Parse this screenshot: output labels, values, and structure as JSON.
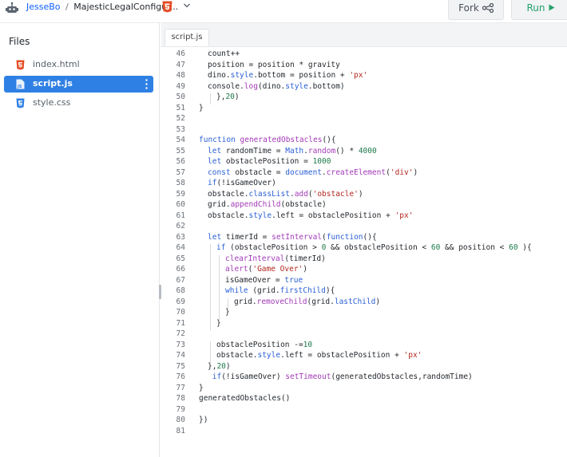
{
  "header": {
    "owner": "JesseBo",
    "separator": "/",
    "repl_name": "MajesticLegalConfigur...",
    "fork_label": "Fork",
    "run_label": "Run"
  },
  "sidebar": {
    "title": "Files",
    "files": [
      {
        "name": "index.html",
        "type": "html"
      },
      {
        "name": "script.js",
        "type": "js",
        "active": true
      },
      {
        "name": "style.css",
        "type": "css"
      }
    ]
  },
  "editor": {
    "active_tab": "script.js",
    "lines": [
      {
        "n": "46",
        "indent": 1,
        "code": [
          [
            "count++",
            ""
          ]
        ]
      },
      {
        "n": "47",
        "indent": 1,
        "code": [
          [
            "position = position * gravity",
            ""
          ]
        ]
      },
      {
        "n": "48",
        "indent": 1,
        "code": [
          [
            "dino.",
            ""
          ],
          [
            "style",
            "kw"
          ],
          [
            ".bottom = position + ",
            ""
          ],
          [
            "'px'",
            "str"
          ]
        ]
      },
      {
        "n": "49",
        "indent": 1,
        "code": [
          [
            "console.",
            ""
          ],
          [
            "log",
            "fn"
          ],
          [
            "(dino.",
            ""
          ],
          [
            "style",
            "kw"
          ],
          [
            ".bottom)",
            ""
          ]
        ]
      },
      {
        "n": "50",
        "indent": 2,
        "code": [
          [
            "},",
            ""
          ],
          [
            "20",
            "num"
          ],
          [
            ")",
            ""
          ]
        ]
      },
      {
        "n": "51",
        "indent": 0,
        "code": [
          [
            "}",
            ""
          ]
        ]
      },
      {
        "n": "52",
        "indent": 0,
        "code": []
      },
      {
        "n": "53",
        "indent": 0,
        "code": []
      },
      {
        "n": "54",
        "indent": 0,
        "code": [
          [
            "function",
            "kw"
          ],
          [
            " ",
            ""
          ],
          [
            "generatedObstacles",
            "fn"
          ],
          [
            "(){",
            ""
          ]
        ]
      },
      {
        "n": "55",
        "indent": 1,
        "code": [
          [
            "let",
            "kw"
          ],
          [
            " randomTime = ",
            ""
          ],
          [
            "Math",
            "kw"
          ],
          [
            ".",
            ""
          ],
          [
            "random",
            "fn"
          ],
          [
            "() * ",
            ""
          ],
          [
            "4000",
            "num"
          ]
        ]
      },
      {
        "n": "56",
        "indent": 1,
        "code": [
          [
            "let",
            "kw"
          ],
          [
            " obstaclePosition = ",
            ""
          ],
          [
            "1000",
            "num"
          ]
        ]
      },
      {
        "n": "57",
        "indent": 1,
        "code": [
          [
            "const",
            "kw"
          ],
          [
            " obstacle = ",
            ""
          ],
          [
            "document",
            "kw"
          ],
          [
            ".",
            ""
          ],
          [
            "createElement",
            "fn"
          ],
          [
            "(",
            ""
          ],
          [
            "'div'",
            "str"
          ],
          [
            ")",
            ""
          ]
        ]
      },
      {
        "n": "58",
        "indent": 1,
        "code": [
          [
            "if",
            "kw"
          ],
          [
            "(!isGameOver)",
            ""
          ]
        ]
      },
      {
        "n": "59",
        "indent": 1,
        "code": [
          [
            "obstacle.",
            ""
          ],
          [
            "classList",
            "kw"
          ],
          [
            ".",
            ""
          ],
          [
            "add",
            "fn"
          ],
          [
            "(",
            ""
          ],
          [
            "'obstacle'",
            "str"
          ],
          [
            ")",
            ""
          ]
        ]
      },
      {
        "n": "60",
        "indent": 1,
        "code": [
          [
            "grid.",
            ""
          ],
          [
            "appendChild",
            "fn"
          ],
          [
            "(obstacle)",
            ""
          ]
        ]
      },
      {
        "n": "61",
        "indent": 1,
        "code": [
          [
            "obstacle.",
            ""
          ],
          [
            "style",
            "kw"
          ],
          [
            ".left = obstaclePosition + ",
            ""
          ],
          [
            "'px'",
            "str"
          ]
        ]
      },
      {
        "n": "62",
        "indent": 0,
        "code": []
      },
      {
        "n": "63",
        "indent": 1,
        "code": [
          [
            "let",
            "kw"
          ],
          [
            " timerId = ",
            ""
          ],
          [
            "setInterval",
            "fn"
          ],
          [
            "(",
            ""
          ],
          [
            "function",
            "kw"
          ],
          [
            "(){",
            ""
          ]
        ]
      },
      {
        "n": "64",
        "indent": 2,
        "code": [
          [
            "if",
            "kw"
          ],
          [
            " (obstaclePosition > ",
            ""
          ],
          [
            "0",
            "num"
          ],
          [
            " && obstaclePosition < ",
            ""
          ],
          [
            "60",
            "num"
          ],
          [
            " && position < ",
            ""
          ],
          [
            "60",
            "num"
          ],
          [
            " ){",
            ""
          ]
        ]
      },
      {
        "n": "65",
        "indent": 3,
        "code": [
          [
            "clearInterval",
            "fn"
          ],
          [
            "(timerId)",
            ""
          ]
        ]
      },
      {
        "n": "66",
        "indent": 3,
        "code": [
          [
            "alert",
            "fn"
          ],
          [
            "(",
            ""
          ],
          [
            "'Game Over'",
            "str"
          ],
          [
            ")",
            ""
          ]
        ]
      },
      {
        "n": "67",
        "indent": 3,
        "code": [
          [
            "isGameOver = ",
            ""
          ],
          [
            "true",
            "kw"
          ]
        ]
      },
      {
        "n": "68",
        "indent": 3,
        "code": [
          [
            "while",
            "kw"
          ],
          [
            " (grid.",
            ""
          ],
          [
            "firstChild",
            "kw"
          ],
          [
            "){",
            ""
          ]
        ]
      },
      {
        "n": "69",
        "indent": 4,
        "code": [
          [
            "grid.",
            ""
          ],
          [
            "removeChild",
            "fn"
          ],
          [
            "(grid.",
            ""
          ],
          [
            "lastChild",
            "kw"
          ],
          [
            ")",
            ""
          ]
        ]
      },
      {
        "n": "70",
        "indent": 3,
        "code": [
          [
            "}",
            ""
          ]
        ]
      },
      {
        "n": "71",
        "indent": 2,
        "code": [
          [
            "}",
            ""
          ]
        ]
      },
      {
        "n": "72",
        "indent": 0,
        "code": []
      },
      {
        "n": "73",
        "indent": 2,
        "code": [
          [
            "obstaclePosition -=",
            ""
          ],
          [
            "10",
            "num"
          ]
        ]
      },
      {
        "n": "74",
        "indent": 2,
        "code": [
          [
            "obstacle.",
            ""
          ],
          [
            "style",
            "kw"
          ],
          [
            ".left = obstaclePosition + ",
            ""
          ],
          [
            "'px'",
            "str"
          ]
        ]
      },
      {
        "n": "75",
        "indent": 1,
        "code": [
          [
            "},",
            ""
          ],
          [
            "20",
            "num"
          ],
          [
            ")",
            ""
          ]
        ]
      },
      {
        "n": "76",
        "indent": 1,
        "code": [
          [
            " ",
            ""
          ],
          [
            "if",
            "kw"
          ],
          [
            "(!isGameOver) ",
            ""
          ],
          [
            "setTimeout",
            "fn"
          ],
          [
            "(generatedObstacles,randomTime)",
            ""
          ]
        ]
      },
      {
        "n": "77",
        "indent": 0,
        "code": [
          [
            "}",
            ""
          ]
        ]
      },
      {
        "n": "78",
        "indent": 0,
        "code": [
          [
            "generatedObstacles()",
            ""
          ]
        ]
      },
      {
        "n": "79",
        "indent": 0,
        "code": []
      },
      {
        "n": "80",
        "indent": 0,
        "code": [
          [
            "})",
            ""
          ]
        ]
      },
      {
        "n": "81",
        "indent": 0,
        "code": []
      }
    ]
  },
  "colors": {
    "accent": "#2f80e4",
    "run": "#26a269",
    "html_icon": "#e44d26",
    "js_icon": "#2f80e4",
    "css_icon": "#2f80e4",
    "keyword": "#2a5fd6",
    "function": "#a33ab8",
    "string": "#b3261e",
    "number": "#1d7a4a"
  },
  "icons": {
    "avatar": "user-avatar-icon",
    "html_badge": "html5-badge-icon",
    "chevron": "chevron-down-icon",
    "fork": "fork-icon",
    "run": "play-icon",
    "kebab": "kebab-menu-icon"
  }
}
